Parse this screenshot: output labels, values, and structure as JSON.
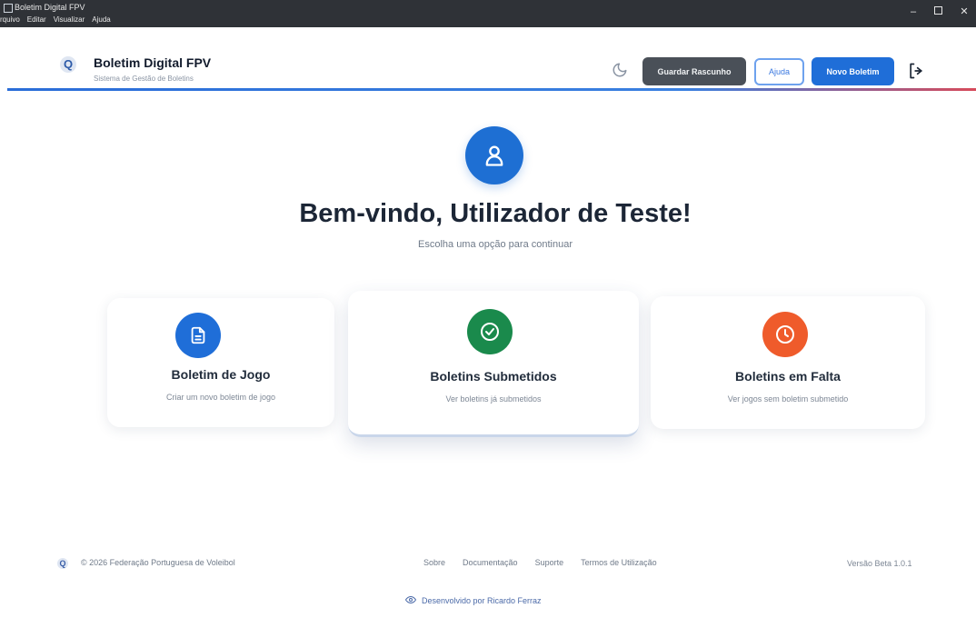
{
  "window": {
    "title": "Boletim Digital FPV",
    "menu": [
      "rquivo",
      "Editar",
      "Visualizar",
      "Ajuda"
    ]
  },
  "header": {
    "brand_title": "Boletim Digital FPV",
    "brand_subtitle": "Sistema de Gestão de Boletins",
    "save_draft_label": "Guardar Rascunho",
    "help_label": "Ajuda",
    "new_report_label": "Novo Boletim"
  },
  "hero": {
    "welcome": "Bem-vindo, Utilizador de Teste!",
    "subtitle": "Escolha uma opção para continuar"
  },
  "cards": [
    {
      "title": "Boletim de Jogo",
      "subtitle": "Criar um novo boletim de jogo",
      "color": "#1f6ed8",
      "icon": "document-icon"
    },
    {
      "title": "Boletins Submetidos",
      "subtitle": "Ver boletins já submetidos",
      "color": "#1a8a4c",
      "icon": "check-circle-icon"
    },
    {
      "title": "Boletins em Falta",
      "subtitle": "Ver jogos sem boletim submetido",
      "color": "#ef5b2b",
      "icon": "clock-icon"
    }
  ],
  "footer": {
    "copyright": "© 2026 Federação Portuguesa de Voleibol",
    "links": [
      "Sobre",
      "Documentação",
      "Suporte",
      "Termos de Utilização"
    ],
    "version": "Versão Beta 1.0.1",
    "developed_by": "Desenvolvido por Ricardo Ferraz"
  },
  "colors": {
    "primary": "#1f6ed8",
    "success": "#1a8a4c",
    "warning": "#ef5b2b",
    "dark_button": "#4a5058"
  }
}
